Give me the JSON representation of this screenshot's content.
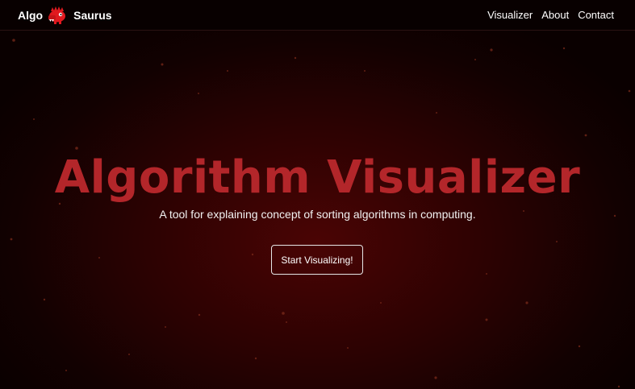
{
  "navbar": {
    "brand_left": "Algo",
    "brand_right": "Saurus",
    "logo_icon": "dinosaur-icon",
    "links": [
      "Visualizer",
      "About",
      "Contact"
    ]
  },
  "hero": {
    "title": "Algorithm Visualizer",
    "subtitle": "A tool for explaining concept of sorting algorithms in computing.",
    "cta_label": "Start Visualizing!"
  },
  "colors": {
    "accent": "#b3262a",
    "logo_red": "#e0191f",
    "background_center": "#4a0404",
    "background_edge": "#0a0000",
    "particle": "#7a2a1a"
  }
}
